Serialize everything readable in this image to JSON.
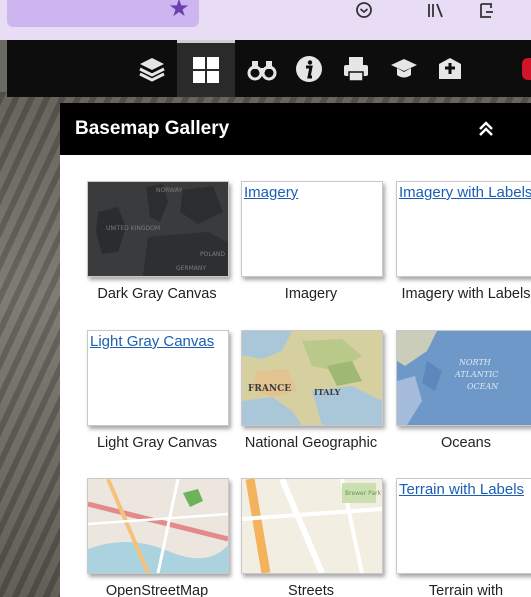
{
  "panel": {
    "title": "Basemap Gallery"
  },
  "tiles": [
    {
      "caption": "Dark Gray Canvas",
      "link": "",
      "map_labels": [
        "NORWAY",
        "UNITED KINGDOM",
        "GERMANY",
        "POLAND"
      ]
    },
    {
      "caption": "Imagery",
      "link": "Imagery"
    },
    {
      "caption": "Imagery with Labels",
      "link": "Imagery with Labels"
    },
    {
      "caption": "Light Gray Canvas",
      "link": "Light Gray Canvas"
    },
    {
      "caption": "National Geographic",
      "link": "",
      "map_labels": [
        "FRANCE",
        "ITALY"
      ]
    },
    {
      "caption": "Oceans",
      "link": "",
      "map_labels": [
        "NORTH",
        "ATLANTIC",
        "OCEAN"
      ]
    },
    {
      "caption": "OpenStreetMap",
      "link": ""
    },
    {
      "caption": "Streets",
      "link": "",
      "map_labels": [
        "Brewer Park"
      ]
    },
    {
      "caption": "Terrain with",
      "link": "Terrain with Labels"
    }
  ],
  "toolbar": {
    "icons": [
      "layers-icon",
      "basemap-grid-icon",
      "binoculars-icon",
      "info-icon",
      "print-icon",
      "education-icon",
      "add-content-icon"
    ]
  },
  "colors": {
    "link": "#1a5fb4",
    "header": "#000000",
    "toolbar": "#0d0d0d"
  }
}
